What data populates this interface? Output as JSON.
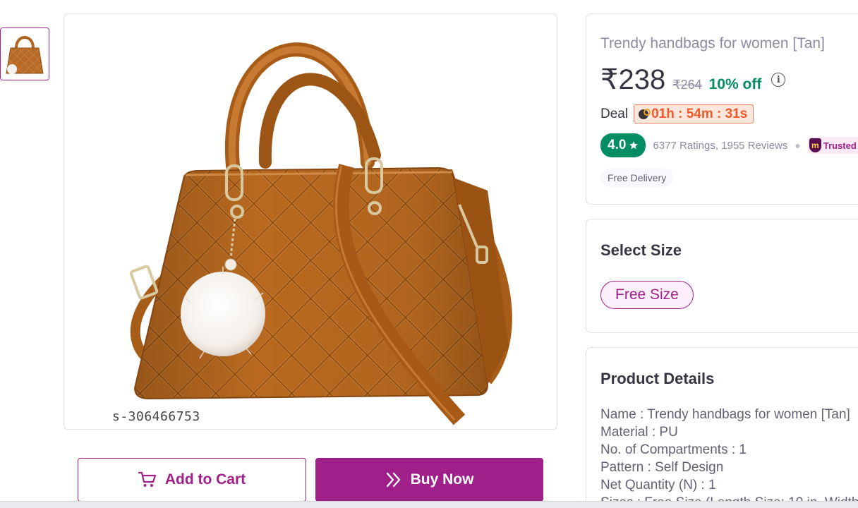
{
  "gallery": {
    "sku_watermark": "s-306466753"
  },
  "actions": {
    "add_to_cart_label": "Add to Cart",
    "buy_now_label": "Buy Now"
  },
  "product": {
    "title": "Trendy handbags for women [Tan]",
    "price": "₹238",
    "mrp": "₹264",
    "discount": "10% off",
    "deal_label": "Deal",
    "deal_timer": "01h : 54m : 31s",
    "rating": "4.0",
    "ratings_reviews": "6377 Ratings, 1955 Reviews",
    "trusted_label": "Trusted",
    "free_delivery": "Free Delivery"
  },
  "size_section": {
    "title": "Select Size",
    "options": [
      "Free Size"
    ],
    "selected": "Free Size"
  },
  "details_section": {
    "title": "Product Details",
    "lines": [
      "Name : Trendy handbags for women [Tan]",
      "Material : PU",
      "No. of Compartments : 1",
      "Pattern : Self Design",
      "Net Quantity (N) : 1",
      "Sizes : Free Size (Length Size: 10 in, Width"
    ]
  },
  "colors": {
    "brand": "#9f2089",
    "rating_green": "#038d63",
    "deal_orange": "#f05a2b",
    "bag_tan": "#b66a26"
  }
}
